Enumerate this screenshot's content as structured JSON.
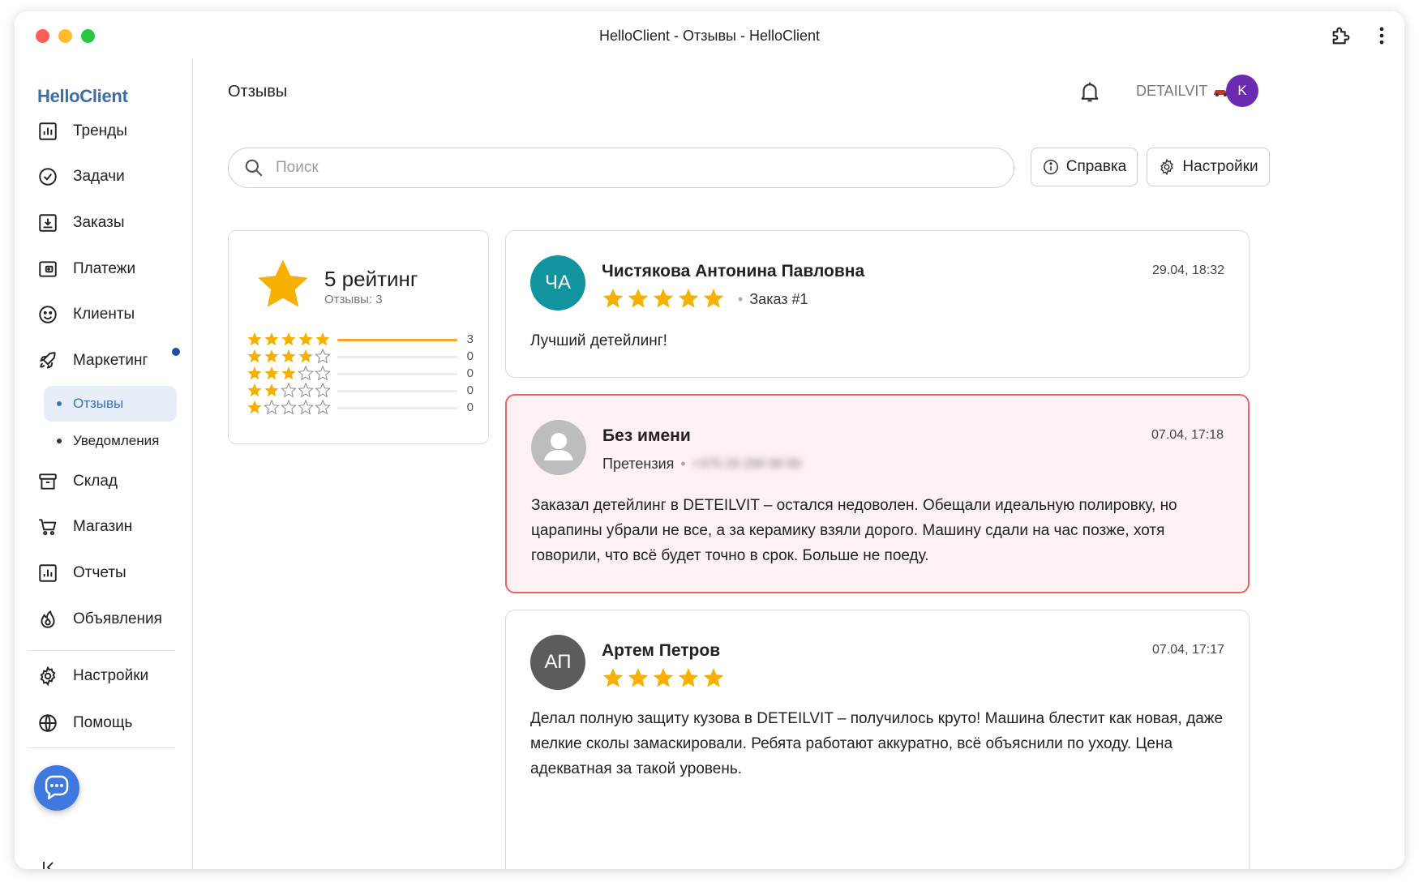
{
  "window": {
    "title": "HelloClient - Отзывы - HelloClient"
  },
  "sidebar": {
    "brand": "HelloClient",
    "items": [
      {
        "label": "Тренды",
        "icon": "chart-icon"
      },
      {
        "label": "Задачи",
        "icon": "check-circle-icon"
      },
      {
        "label": "Заказы",
        "icon": "download-box-icon"
      },
      {
        "label": "Платежи",
        "icon": "wallet-icon"
      },
      {
        "label": "Клиенты",
        "icon": "smile-icon"
      },
      {
        "label": "Маркетинг",
        "icon": "rocket-icon"
      }
    ],
    "sub_items": [
      {
        "label": "Отзывы",
        "active": true
      },
      {
        "label": "Уведомления",
        "active": false
      }
    ],
    "items2": [
      {
        "label": "Склад",
        "icon": "archive-icon"
      },
      {
        "label": "Магазин",
        "icon": "cart-icon"
      },
      {
        "label": "Отчеты",
        "icon": "report-icon"
      },
      {
        "label": "Объявления",
        "icon": "fire-icon"
      }
    ],
    "items3": [
      {
        "label": "Настройки",
        "icon": "gear-icon"
      },
      {
        "label": "Помощь",
        "icon": "globe-icon"
      }
    ]
  },
  "header": {
    "page_title": "Отзывы",
    "company": "DETAILVIT",
    "avatar_letter": "K"
  },
  "search": {
    "placeholder": "Поиск",
    "value": ""
  },
  "toolbar": {
    "help_label": "Справка",
    "settings_label": "Настройки"
  },
  "rating": {
    "title": "5 рейтинг",
    "subtitle": "Отзывы: 3",
    "distribution": [
      {
        "stars": 5,
        "count": "3",
        "fraction": 1.0
      },
      {
        "stars": 4,
        "count": "0",
        "fraction": 0
      },
      {
        "stars": 3,
        "count": "0",
        "fraction": 0
      },
      {
        "stars": 2,
        "count": "0",
        "fraction": 0
      },
      {
        "stars": 1,
        "count": "0",
        "fraction": 0
      }
    ]
  },
  "reviews": [
    {
      "initials": "ЧА",
      "avatar_color": "#12949e",
      "name": "Чистякова Антонина Павловна",
      "date": "29.04, 18:32",
      "stars": 5,
      "order": "Заказ #1",
      "text": "Лучший детейлинг!"
    },
    {
      "initials": "",
      "avatar_color": "#bdbdbd",
      "name": "Без имени",
      "date": "07.04, 17:18",
      "claim": "Претензия",
      "phone": "+375 29 299 99 99",
      "text": "Заказал детейлинг в DETEILVIT – остался недоволен. Обещали идеальную полировку, но царапины убрали не все, а за керамику взяли дорого. Машину сдали на час позже, хотя говорили, что всё будет точно в срок. Больше не поеду."
    },
    {
      "initials": "АП",
      "avatar_color": "#5c5c5c",
      "name": "Артем Петров",
      "date": "07.04, 17:17",
      "stars": 5,
      "text": "Делал полную защиту кузова в DETEILVIT – получилось круто! Машина блестит как новая, даже мелкие сколы замаскировали. Ребята работают аккуратно, всё объяснили по уходу. Цена адекватная за такой уровень."
    }
  ],
  "colors": {
    "accent": "#3f6fb4",
    "star": "#f5b000",
    "flag_border": "#e86565",
    "flag_bg": "#fdf1f1"
  }
}
